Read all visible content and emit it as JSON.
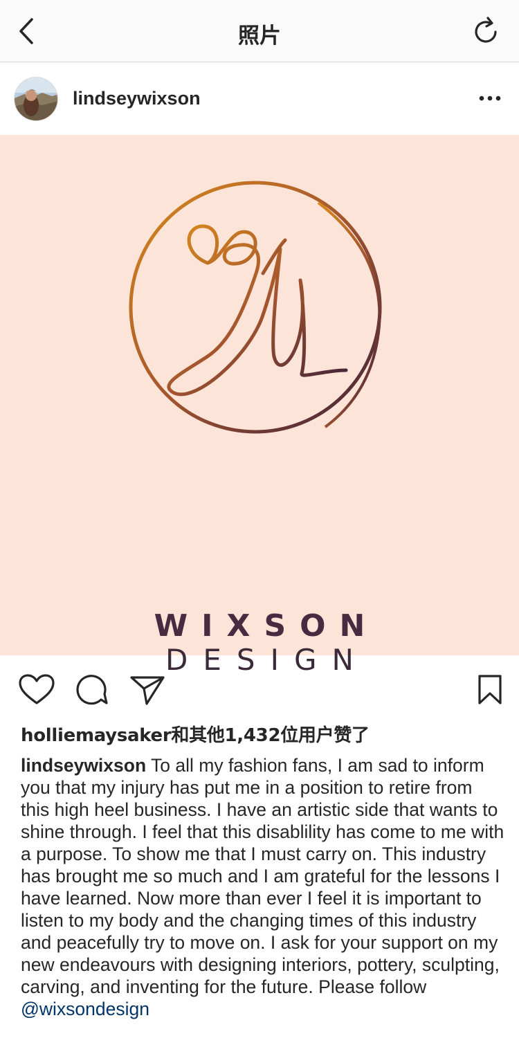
{
  "nav": {
    "title": "照片",
    "back_icon": "chevron-left-icon",
    "refresh_icon": "refresh-icon"
  },
  "post": {
    "username": "lindseywixson",
    "more_icon": "ellipsis-icon"
  },
  "image": {
    "brand_line1": "WIXSON",
    "brand_line2": "DESIGN",
    "background_color": "#fce4d8",
    "logo_gradient": [
      "#d4811f",
      "#3a1f3a"
    ]
  },
  "actions": {
    "like_icon": "heart-icon",
    "comment_icon": "comment-icon",
    "share_icon": "paper-plane-icon",
    "save_icon": "bookmark-icon"
  },
  "likes_text": "holliemaysaker和其他1,432位用户赞了",
  "caption": {
    "username": "lindseywixson",
    "text": " To all my fashion fans, I am sad to inform you that my injury has put me in a position to retire from this high heel business. I have an artistic side that wants to shine through. I feel that this disablility has come to me with a purpose. To show me that I must carry on. This industry has brought me so much and I am grateful for the lessons I have learned. Now more than ever I feel it is important to listen to my body and the changing times of this industry and peacefully try to move on. I ask for your support on my new endeavours with designing interiors, pottery, sculpting, carving, and inventing for the future. Please follow ",
    "mention": "@wixsondesign",
    "mention_color": "#003569"
  }
}
